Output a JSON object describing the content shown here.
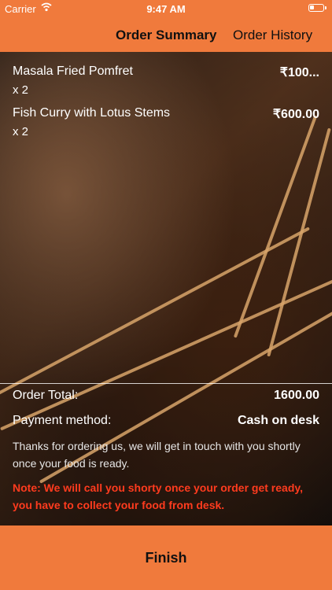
{
  "status": {
    "carrier": "Carrier",
    "time": "9:47 AM"
  },
  "tabs": {
    "summary": "Order Summary",
    "history": "Order History"
  },
  "items": [
    {
      "name": "Masala Fried Pomfret",
      "qty": "x 2",
      "price": "₹100..."
    },
    {
      "name": "Fish Curry with Lotus Stems",
      "qty": "x 2",
      "price": "₹600.00"
    }
  ],
  "summary": {
    "total_label": "Order Total:",
    "total_value": "1600.00",
    "payment_label": "Payment method:",
    "payment_value": "Cash on desk",
    "thanks": "Thanks for ordering us, we will get in touch with you shortly once your food is ready.",
    "note": "Note: We will call you shorty once your order get ready, you have to collect your food from desk."
  },
  "finish_label": "Finish",
  "colors": {
    "accent": "#f07a3c",
    "note": "#ff3b1e"
  }
}
